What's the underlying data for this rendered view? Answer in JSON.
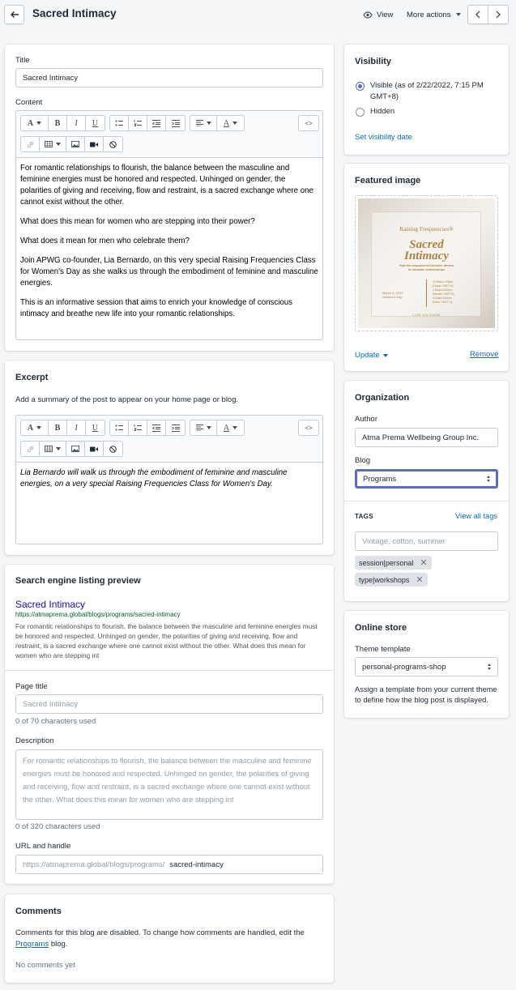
{
  "header": {
    "page_title": "Sacred Intimacy",
    "view_label": "View",
    "more_actions_label": "More actions"
  },
  "title_section": {
    "title_label": "Title",
    "title_value": "Sacred Intimacy",
    "content_label": "Content",
    "content_paragraphs": [
      "For romantic relationships to flourish, the balance between the masculine and feminine energies must be honored and respected. Unhinged on gender, the polarities of giving and receiving, flow and restraint, is a sacred exchange where one cannot exist without the other.",
      "What does this mean for women who are stepping into their power?",
      "What does it mean for men who celebrate them?",
      "Join APWG co-founder, Lia Bernardo, on this very special Raising Frequencies Class for Women's Day as she walks us through the embodiment of feminine and masculine energies.",
      "This is an informative session that aims to enrich your knowledge of conscious intimacy and breathe new life into your romantic relationships."
    ]
  },
  "editor_toolbar": {
    "font_glyph": "A",
    "bold_glyph": "B",
    "italic_glyph": "I",
    "underline_glyph": "U",
    "color_glyph": "A",
    "html_glyph": "<>"
  },
  "excerpt": {
    "heading": "Excerpt",
    "help": "Add a summary of the post to appear on your home page or blog.",
    "text": "Lia Bernardo will walk us through the embodiment of feminine and masculine energies, on a very special Raising Frequencies Class for Women's Day."
  },
  "seo": {
    "heading": "Search engine listing preview",
    "preview_title": "Sacred Intimacy",
    "preview_url": "https://atmaprema.global/blogs/programs/sacred-intimacy",
    "preview_description": "For romantic relationships to flourish, the balance between the masculine and feminine energies must be honored and respected. Unhinged on gender, the polarities of giving and receiving, flow and restraint, is a sacred exchange where one cannot exist without the other. What does this mean for women who are stepping int",
    "page_title_label": "Page title",
    "page_title_placeholder": "Sacred Intimacy",
    "page_title_count": "0 of 70 characters used",
    "description_label": "Description",
    "description_placeholder": "For romantic relationships to flourish, the balance between the masculine and feminine energies must be honored and respected. Unhinged on gender, the polarities of giving and receiving, flow and restraint, is a sacred exchange where one cannot exist without the other. What does this mean for women who are stepping int",
    "description_count": "0 of 320 characters used",
    "url_label": "URL and handle",
    "url_prefix": "https://atmaprema.global/blogs/programs/",
    "url_handle": "sacred-intimacy"
  },
  "comments": {
    "heading": "Comments",
    "text_before": "Comments for this blog are disabled. To change how comments are handled, edit the",
    "link": "Programs",
    "text_after": "blog.",
    "empty": "No comments yet"
  },
  "visibility": {
    "heading": "Visibility",
    "visible_label": "Visible (as of 2/22/2022, 7:15 PM GMT+8)",
    "hidden_label": "Hidden",
    "set_date_link": "Set visibility date",
    "selected": "visible"
  },
  "featured_image": {
    "heading": "Featured image",
    "update_label": "Update",
    "remove_label": "Remove",
    "poster": {
      "brand": "Raising Frequencies®",
      "title_line1": "Sacred",
      "title_line2": "Intimacy",
      "subtitle_line1": "How the empowered feminine thrives",
      "subtitle_line2": "in romantic relationships",
      "date_line1": "March 8, 2022",
      "date_line2": "Women's Day",
      "times": [
        "11:00am-1:00pm",
        "(Dubai / GMT+4)",
        "3:00pm-5:00pm",
        "(Manila / GMT+8)",
        "6:00am-8:00am",
        "(Paris / GMT+1)"
      ],
      "footer": "LIVE VIA ZOOM"
    }
  },
  "organization": {
    "heading": "Organization",
    "author_label": "Author",
    "author_value": "Atma Prema Wellbeing Group Inc.",
    "blog_label": "Blog",
    "blog_value": "Programs",
    "tags_label": "TAGS",
    "view_all_tags": "View all tags",
    "tags_placeholder": "Vintage, cotton, summer",
    "tags": [
      "session|personal",
      "type|workshops"
    ]
  },
  "online_store": {
    "heading": "Online store",
    "theme_label": "Theme template",
    "theme_value": "personal-programs-shop",
    "help": "Assign a template from your current theme to define how the blog post is displayed."
  },
  "colors": {
    "accent": "#5c6ac4",
    "link": "#006fbb",
    "seo_title": "#1a0dab",
    "seo_url": "#006621",
    "poster_gold": "#a88440"
  }
}
